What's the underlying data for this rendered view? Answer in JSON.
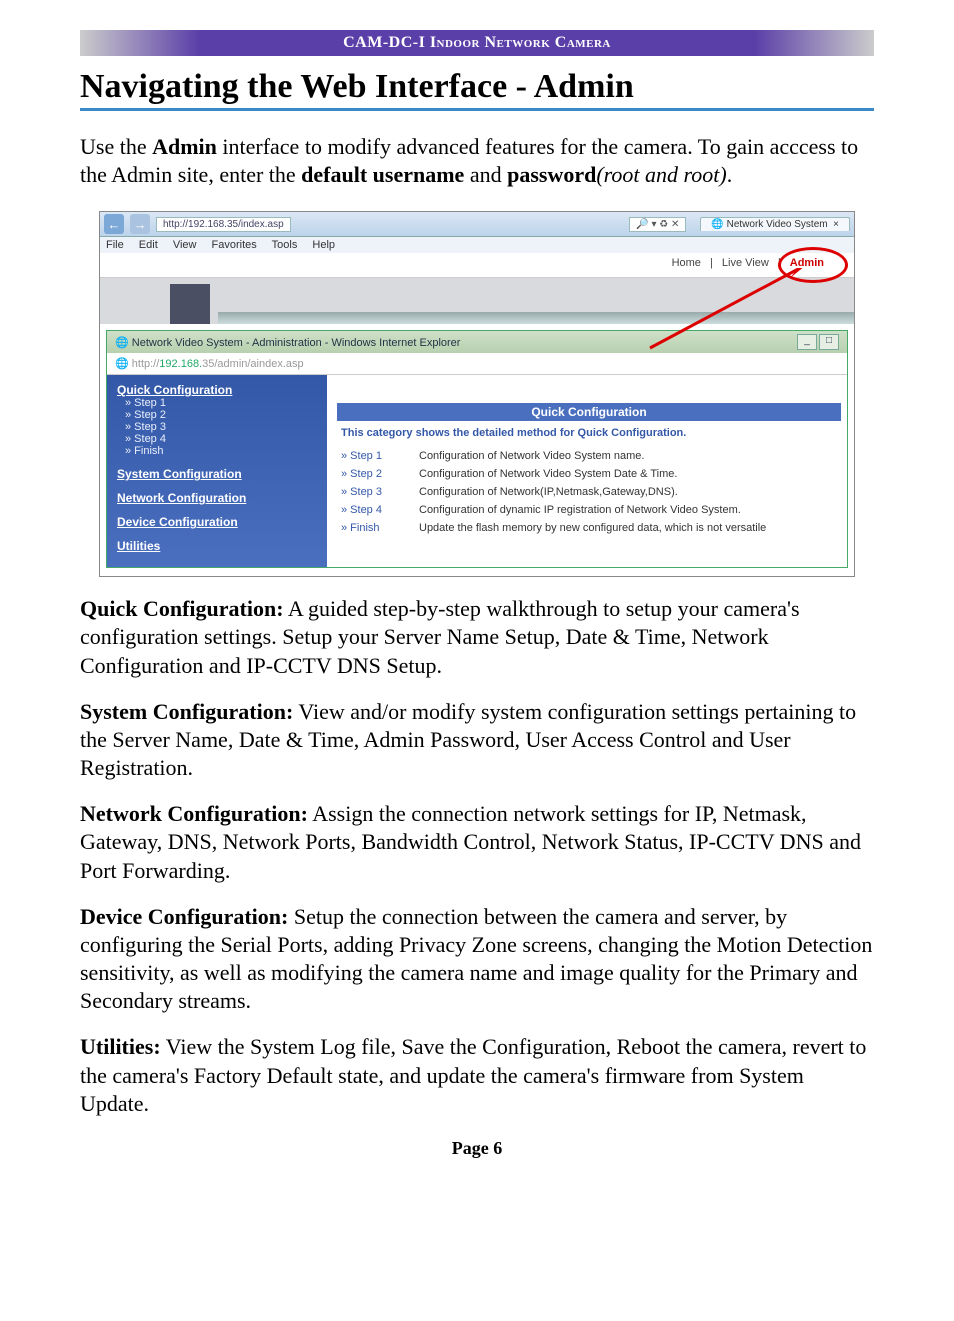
{
  "header_band": "CAM-DC-I Indoor Network Camera",
  "title": "Navigating the Web Interface - Admin",
  "intro": {
    "pre": "Use the ",
    "b1": "Admin",
    "mid1": " interface to modify advanced features for the camera. To gain acccess to the Admin site, enter the ",
    "b2": "default username",
    "mid2": " and ",
    "b3": "password",
    "ital": "(root and root)",
    "end": "."
  },
  "shot": {
    "outer_addr": "http://192.168.35/index.asp",
    "search_hint": "🔎 ▾ ♻ ✕",
    "tab_label": "Network Video System",
    "menu": [
      "File",
      "Edit",
      "View",
      "Favorites",
      "Tools",
      "Help"
    ],
    "links": {
      "home": "Home",
      "live": "Live View",
      "admin": "Admin"
    },
    "inner_title": "Network Video System - Administration - Windows Internet Explorer",
    "inner_addr_pre": "http://",
    "inner_addr_host": "192.168.",
    "inner_addr_rest": "35/admin/aindex.asp",
    "sidebar": {
      "quick": "Quick Configuration",
      "steps": [
        "» Step 1",
        "» Step 2",
        "» Step 3",
        "» Step 4",
        "» Finish"
      ],
      "system": "System Configuration",
      "network": "Network Configuration",
      "device": "Device Configuration",
      "util": "Utilities"
    },
    "content": {
      "heading": "Quick Configuration",
      "sub": "This category shows the detailed method for Quick Configuration.",
      "rows": [
        {
          "step": "» Step 1",
          "desc": "Configuration of Network Video System name."
        },
        {
          "step": "» Step 2",
          "desc": "Configuration of Network Video System Date & Time."
        },
        {
          "step": "» Step 3",
          "desc": "Configuration of Network(IP,Netmask,Gateway,DNS)."
        },
        {
          "step": "» Step 4",
          "desc": "Configuration of dynamic IP registration of Network Video System."
        },
        {
          "step": "» Finish",
          "desc": "Update the flash memory by new configured data, which is not versatile"
        }
      ]
    }
  },
  "sections": {
    "quick": {
      "label": "Quick Configuration:",
      "text": " A guided step-by-step walkthrough to setup your camera's configuration settings. Setup your Server Name Setup, Date & Time, Network Configuration and IP-CCTV DNS Setup."
    },
    "system": {
      "label": "System Configuration:",
      "text": " View and/or modify system configuration settings pertaining to the Server Name, Date & Time, Admin Password, User Access Control and User Registration."
    },
    "network": {
      "label": "Network Configuration:",
      "text": " Assign the connection network settings for IP, Netmask, Gateway, DNS, Network Ports, Bandwidth Control, Network Status, IP-CCTV DNS and Port Forwarding."
    },
    "device": {
      "label": "Device Configuration:",
      "text": " Setup the connection between the camera and server, by configuring the Serial Ports, adding Privacy Zone screens, changing the Motion Detection sensitivity, as well as modifying the camera name and image quality for the Primary and Secondary streams."
    },
    "util": {
      "label": "Utilities:",
      "text": " View the System Log file, Save the Configuration, Reboot the camera, revert to the camera's Factory Default state, and update the camera's firmware from System Update."
    }
  },
  "page_label": "Page 6"
}
